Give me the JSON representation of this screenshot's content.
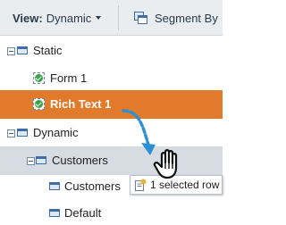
{
  "toolbar": {
    "view_label": "View:",
    "view_value": "Dynamic",
    "segment_label": "Segment By"
  },
  "tree": {
    "static_folder": "Static",
    "form_1": "Form 1",
    "rich_text_1": "Rich Text 1",
    "dynamic_folder": "Dynamic",
    "customers_folder": "Customers",
    "customers_item": "Customers",
    "default_item": "Default"
  },
  "drag_tooltip": "1 selected row",
  "colors": {
    "selected_row": "#e17a2a",
    "hover_row": "#d7dce2",
    "drag_arrow": "#2f8fd3"
  },
  "icons": {
    "segment": "segment-icon",
    "folder": "folder-icon",
    "form": "form-check-icon",
    "cursor": "hand-cursor-icon"
  }
}
